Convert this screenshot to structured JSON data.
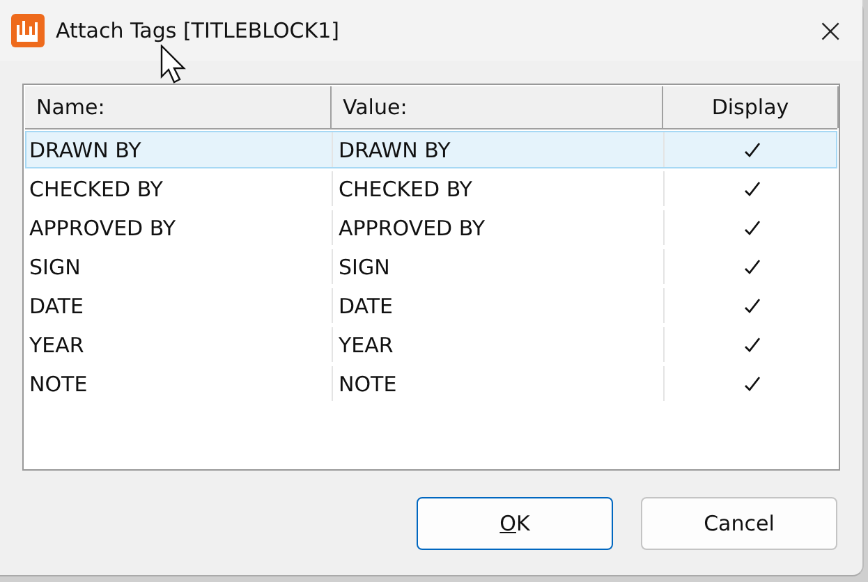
{
  "window": {
    "title": "Attach Tags [TITLEBLOCK1]",
    "close": "×"
  },
  "table": {
    "columns": [
      "Name:",
      "Value:",
      "Display"
    ],
    "rows": [
      {
        "name": "DRAWN BY",
        "value": "DRAWN BY",
        "display": true,
        "selected": true
      },
      {
        "name": "CHECKED BY",
        "value": "CHECKED BY",
        "display": true,
        "selected": false
      },
      {
        "name": "APPROVED BY",
        "value": "APPROVED BY",
        "display": true,
        "selected": false
      },
      {
        "name": "SIGN",
        "value": "SIGN",
        "display": true,
        "selected": false
      },
      {
        "name": "DATE",
        "value": "DATE",
        "display": true,
        "selected": false
      },
      {
        "name": "YEAR",
        "value": "YEAR",
        "display": true,
        "selected": false
      },
      {
        "name": "NOTE",
        "value": "NOTE",
        "display": true,
        "selected": false
      }
    ]
  },
  "buttons": [
    {
      "label": "OK",
      "first_letter_underlined": true,
      "default": true
    },
    {
      "label": "Cancel",
      "default": false
    }
  ]
}
